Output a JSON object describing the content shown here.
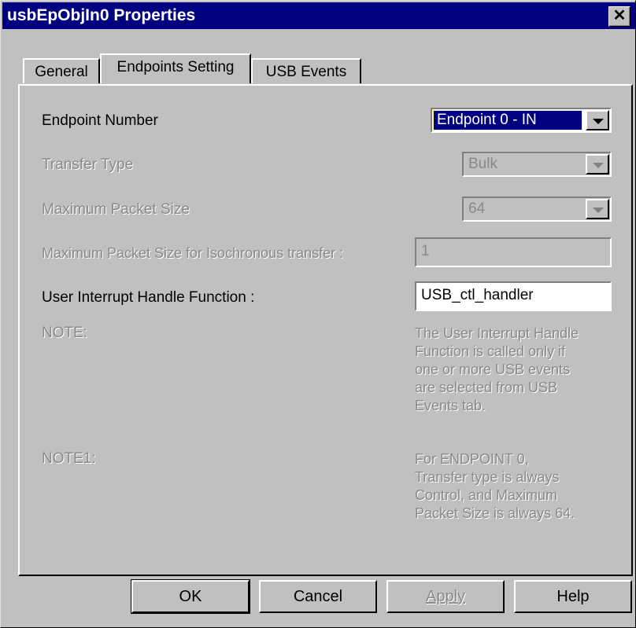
{
  "window": {
    "title": "usbEpObjIn0 Properties",
    "close_glyph": "✕"
  },
  "tabs": [
    {
      "label": "General"
    },
    {
      "label": "Endpoints Setting"
    },
    {
      "label": "USB Events"
    }
  ],
  "form": {
    "endpoint_number": {
      "label": "Endpoint Number",
      "value": "Endpoint 0 - IN"
    },
    "transfer_type": {
      "label": "Transfer Type",
      "value": "Bulk"
    },
    "max_packet_size": {
      "label": "Maximum Packet Size",
      "value": "64"
    },
    "max_packet_iso": {
      "label": "Maximum Packet Size for Isochronous transfer :",
      "value": "1"
    },
    "user_interrupt": {
      "label": "User Interrupt Handle Function :",
      "value": "USB_ctl_handler"
    }
  },
  "notes": [
    {
      "label": "NOTE:",
      "lines": [
        "The User Interrupt Handle",
        "Function is called only if",
        "one or more USB events",
        "are selected from USB",
        "Events tab."
      ]
    },
    {
      "label": "NOTE1:",
      "lines": [
        "For ENDPOINT 0,",
        "Transfer type is always",
        "Control, and Maximum",
        "Packet Size is always 64."
      ]
    }
  ],
  "buttons": {
    "ok": "OK",
    "cancel": "Cancel",
    "apply": "Apply",
    "help": "Help"
  },
  "icons": {
    "close": "close-icon",
    "dropdown": "chevron-down-icon"
  }
}
